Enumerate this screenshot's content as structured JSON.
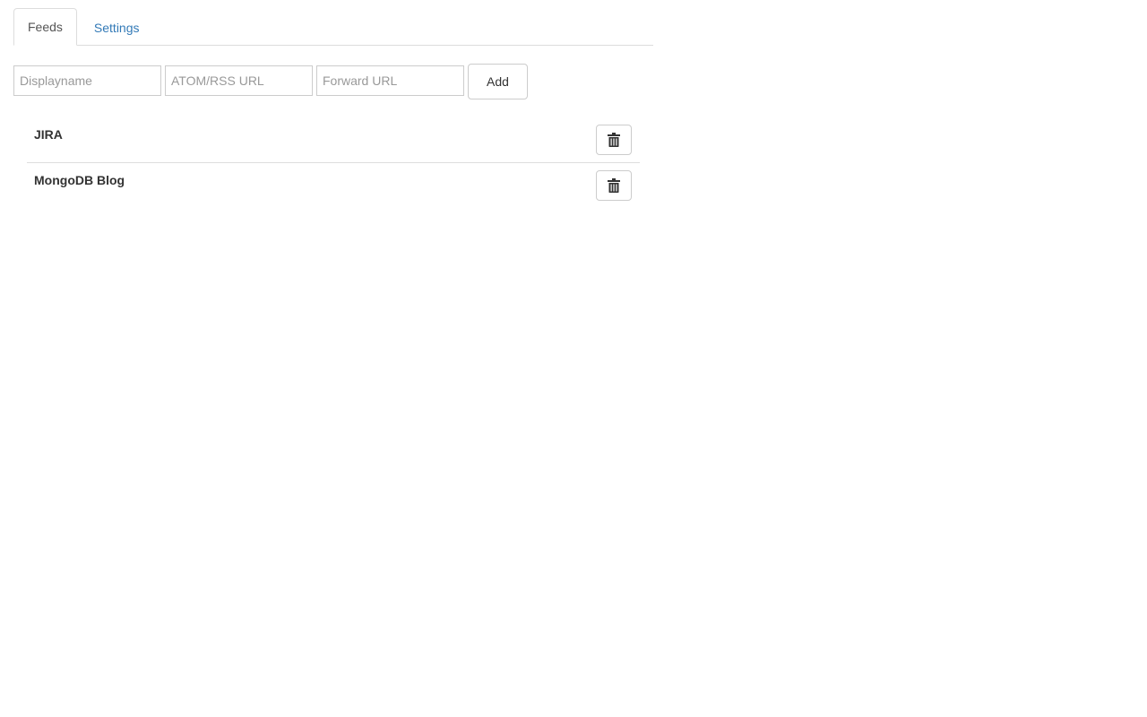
{
  "tabs": [
    {
      "label": "Feeds",
      "active": true
    },
    {
      "label": "Settings",
      "active": false
    }
  ],
  "form": {
    "displayname_placeholder": "Displayname",
    "feed_url_placeholder": "ATOM/RSS URL",
    "forward_url_placeholder": "Forward URL",
    "displayname_value": "",
    "feed_url_value": "",
    "forward_url_value": "",
    "add_label": "Add"
  },
  "feeds": [
    {
      "name": "JIRA",
      "action_icon": "trash-icon"
    },
    {
      "name": "MongoDB Blog",
      "action_icon": "trash-icon"
    }
  ],
  "colors": {
    "link": "#337ab7",
    "border": "#dddddd",
    "text": "#333333"
  }
}
